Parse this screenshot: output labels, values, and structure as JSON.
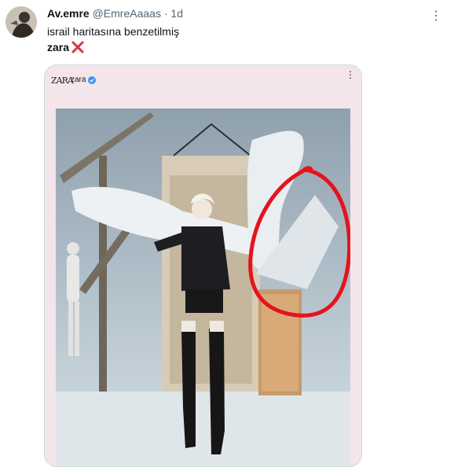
{
  "tweet": {
    "display_name": "Av.emre",
    "handle": "@EmreAaaas",
    "separator": "·",
    "time": "1d",
    "more_icon": "⋮",
    "text_line1": "israil haritasına benzetilmiş",
    "text_line2": "zara",
    "emoji": "cross-mark-icon"
  },
  "embedded_post": {
    "logo": "ZARA",
    "account": "zara",
    "more_icon": "⋮"
  }
}
